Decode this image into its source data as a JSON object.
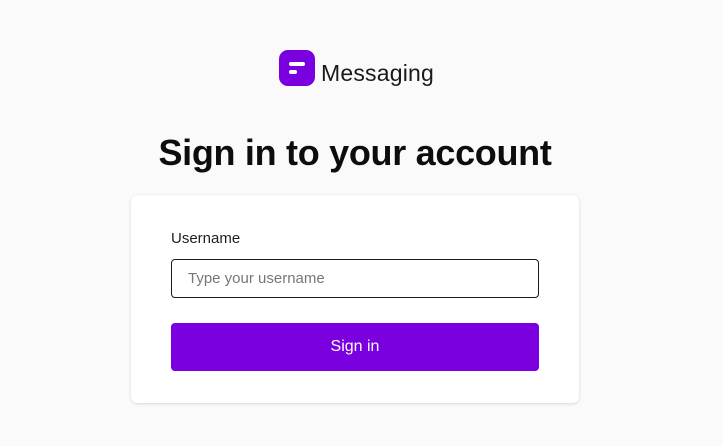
{
  "brand": {
    "name": "Messaging",
    "logo_icon": "messaging-logo-icon",
    "color": "#7a00e0"
  },
  "page_title": "Sign in to your account",
  "form": {
    "username_label": "Username",
    "username_placeholder": "Type your username",
    "username_value": "",
    "submit_label": "Sign in"
  }
}
